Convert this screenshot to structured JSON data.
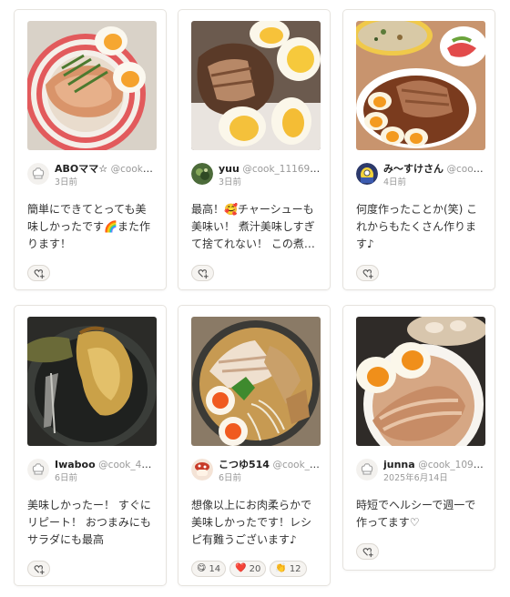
{
  "cards": [
    {
      "user_name": "ABOママ☆",
      "user_id": "@cook_…",
      "date": "3日前",
      "comment": "簡単にできてとっても美味しかったです🌈また作ります！",
      "photo_icon": "braised-chicken-plate-photo"
    },
    {
      "user_name": "yuu",
      "user_id": "@cook_111693…",
      "date": "3日前",
      "comment": "最高！🥰チャーシューも美味い！ 煮汁美味しすぎて捨てれない！ この煮…",
      "photo_icon": "sliced-chashu-eggs-photo"
    },
    {
      "user_name": "み〜すけさん",
      "user_id": "@cook…",
      "date": "4日前",
      "comment": "何度作ったことか(笑) これからもたくさん作ります♪",
      "photo_icon": "chashu-meal-set-photo"
    },
    {
      "user_name": "Iwaboo",
      "user_id": "@cook_401…",
      "date": "6日前",
      "comment": "美味しかったー！ すぐにリピート！ おつまみにもサラダにも最高",
      "photo_icon": "chicken-in-pan-photo"
    },
    {
      "user_name": "こつゆ514",
      "user_id": "@cook_4…",
      "date": "6日前",
      "comment": "想像以上にお肉柔らかで美味しかったです！レシピ有難うございます♪",
      "photo_icon": "ramen-bowl-photo",
      "reactions": [
        {
          "emoji": "😋",
          "count": "14"
        },
        {
          "emoji": "❤️",
          "count": "20"
        },
        {
          "emoji": "👏",
          "count": "12"
        }
      ]
    },
    {
      "user_name": "junna",
      "user_id": "@cook_10917…",
      "date": "2025年6月14日",
      "comment": "時短でヘルシーで週一で作ってます♡",
      "photo_icon": "chashu-egg-bowl-photo"
    }
  ]
}
